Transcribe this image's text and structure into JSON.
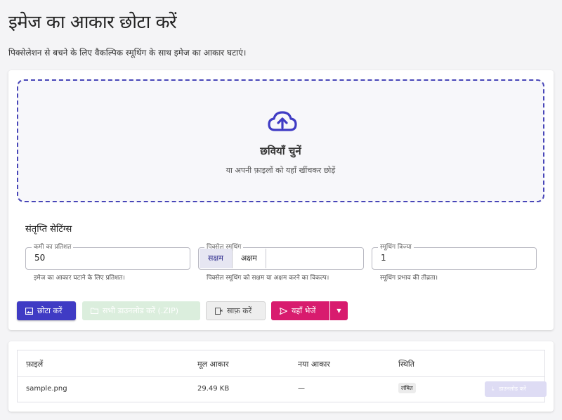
{
  "header": {
    "title": "इमेज का आकार छोटा करें",
    "subtitle": "पिक्सेलेशन से बचने के लिए वैकल्पिक स्मूथिंग के साथ इमेज का आकार घटाएं।"
  },
  "dropzone": {
    "icon": "cloud-upload-icon",
    "title": "छवियाँ चुनें",
    "hint": "या अपनी फ़ाइलों को यहाँ खींचकर छोड़ें"
  },
  "settings": {
    "title": "संतृप्ति सेटिंग्स",
    "reduction": {
      "label": "कमी का प्रतिशत",
      "value": "50",
      "help": "इमेज का आकार घटाने के लिए प्रतिशत।"
    },
    "pixel_smoothing": {
      "label": "पिक्सेल स्मूथिंग",
      "options": [
        "सक्षम",
        "अक्षम"
      ],
      "selected": "सक्षम",
      "help": "पिक्सेल स्मूथिंग को सक्षम या अक्षम करने का विकल्प।"
    },
    "smoothing_radius": {
      "label": "स्मूथिंग त्रिज्या",
      "value": "1",
      "help": "स्मूथिंग प्रभाव की तीव्रता।"
    }
  },
  "actions": {
    "compress": "छोटा करें",
    "download_all": "सभी डाउनलोड करें (.ZIP)",
    "clear": "साफ़ करें",
    "send": "यहाँ भेजें"
  },
  "table": {
    "headers": [
      "फ़ाइलें",
      "मूल आकार",
      "नया आकार",
      "स्थिति"
    ],
    "rows": [
      {
        "file": "sample.png",
        "original_size": "29.49 KB",
        "new_size": "—",
        "status": "लंबित",
        "download": "डाउनलोड करें"
      }
    ]
  },
  "colors": {
    "primary": "#3f3bc4",
    "accent": "#d81b6e",
    "success_disabled": "#dbeedd"
  }
}
